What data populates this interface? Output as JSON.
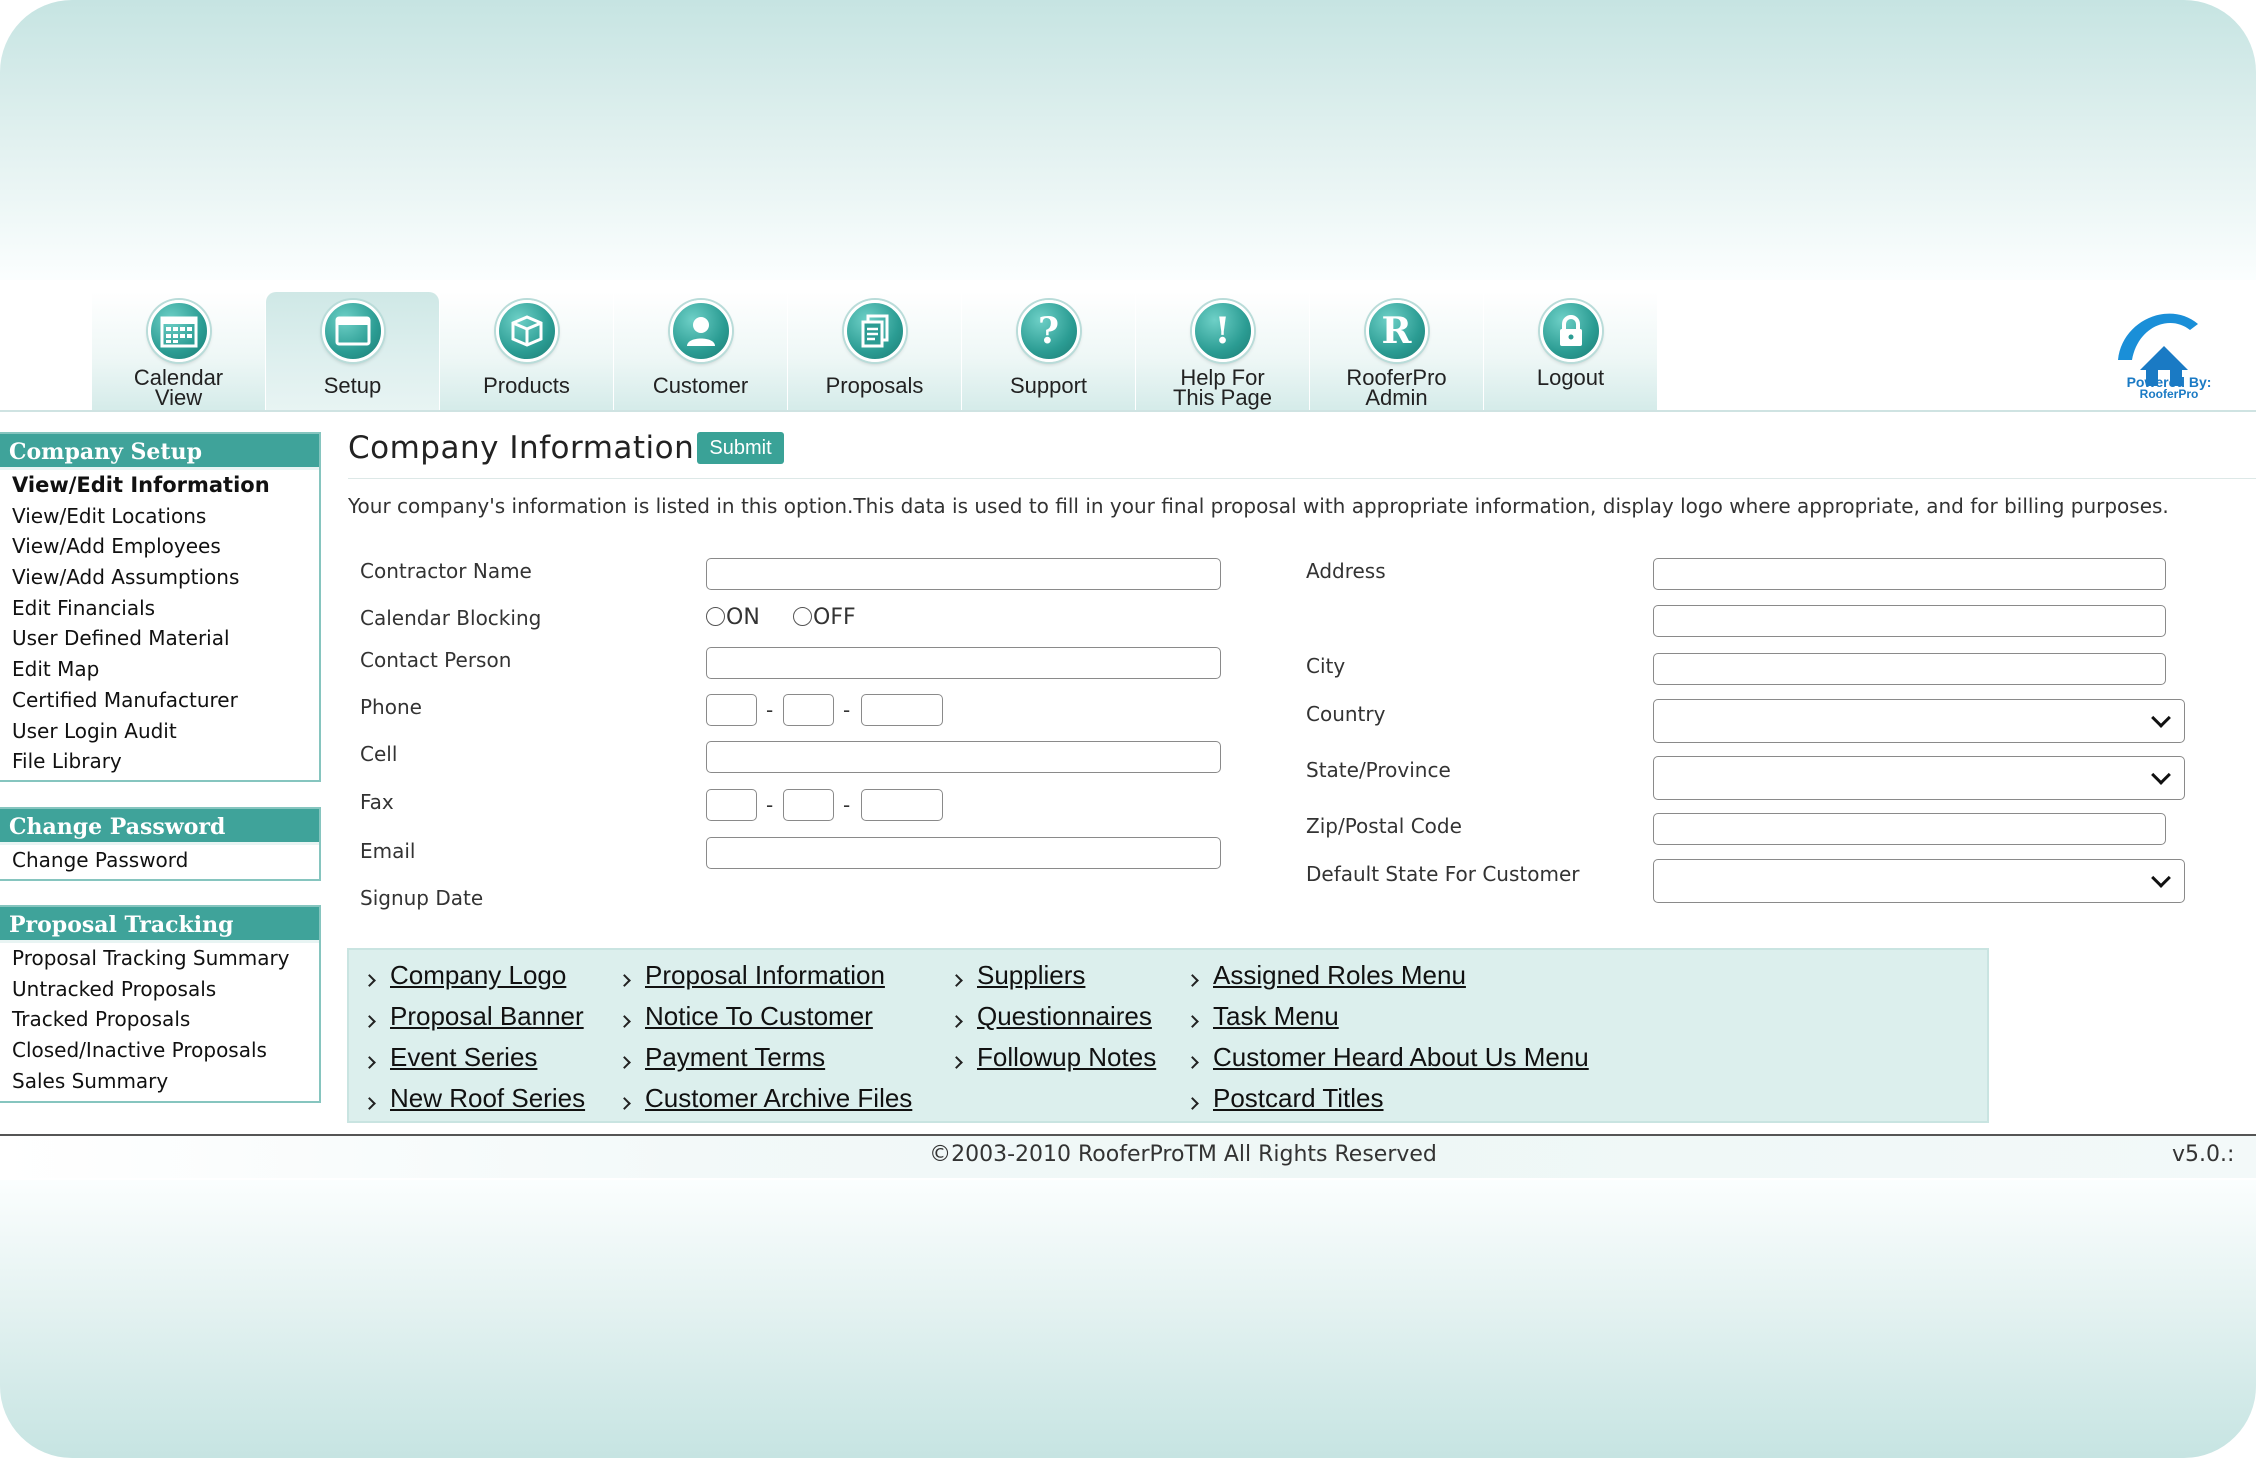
{
  "nav": {
    "tabs": [
      {
        "label": "Calendar\nView",
        "icon": "calendar-icon"
      },
      {
        "label": "Setup",
        "icon": "window-icon"
      },
      {
        "label": "Products",
        "icon": "box-icon"
      },
      {
        "label": "Customer",
        "icon": "person-icon"
      },
      {
        "label": "Proposals",
        "icon": "documents-icon"
      },
      {
        "label": "Support",
        "icon": "question-icon",
        "glyph": "?"
      },
      {
        "label": "Help For\nThis Page",
        "icon": "exclamation-icon",
        "glyph": "!"
      },
      {
        "label": "RooferPro\nAdmin",
        "icon": "r-letter-icon",
        "glyph": "R"
      },
      {
        "label": "Logout",
        "icon": "lock-icon"
      }
    ],
    "active": "Setup"
  },
  "branding": {
    "powered_by": "Powered By:",
    "brand": "RooferPro"
  },
  "sidebar": {
    "company_setup": {
      "title": "Company Setup",
      "items": [
        "View/Edit Information",
        "View/Edit Locations",
        "View/Add Employees",
        "View/Add Assumptions",
        "Edit Financials",
        "User Defined Material",
        "Edit Map",
        "Certified Manufacturer",
        "User Login Audit",
        "File Library"
      ],
      "current": "View/Edit Information"
    },
    "change_password": {
      "title": "Change Password",
      "items": [
        "Change Password"
      ]
    },
    "proposal_tracking": {
      "title": "Proposal Tracking",
      "items": [
        "Proposal Tracking Summary",
        "Untracked Proposals",
        "Tracked Proposals",
        "Closed/Inactive Proposals",
        "Sales Summary"
      ]
    }
  },
  "main": {
    "title": "Company Information",
    "submit_label": "Submit",
    "description": "Your company's information is listed in this option.This data is used to fill in your final proposal with appropriate information, display logo where appropriate, and for billing purposes.",
    "left_fields": {
      "contractor_name": {
        "label": "Contractor Name",
        "value": ""
      },
      "calendar_blocking": {
        "label": "Calendar Blocking",
        "on": "ON",
        "off": "OFF",
        "selected": ""
      },
      "contact_person": {
        "label": "Contact Person",
        "value": ""
      },
      "phone": {
        "label": "Phone",
        "separator": "-"
      },
      "cell": {
        "label": "Cell",
        "value": ""
      },
      "fax": {
        "label": "Fax",
        "separator": "-"
      },
      "email": {
        "label": "Email",
        "value": ""
      },
      "signup_date": {
        "label": "Signup Date",
        "value": ""
      }
    },
    "right_fields": {
      "address": {
        "label": "Address",
        "value1": "",
        "value2": ""
      },
      "city": {
        "label": "City",
        "value": ""
      },
      "country": {
        "label": "Country",
        "selected": ""
      },
      "state": {
        "label": "State/Province",
        "selected": ""
      },
      "zip": {
        "label": "Zip/Postal Code",
        "value": ""
      },
      "default_state": {
        "label": "Default State For Customer",
        "selected": ""
      }
    }
  },
  "links": {
    "col1": [
      "Company Logo",
      "Proposal Banner",
      "Event Series",
      "New Roof Series"
    ],
    "col2": [
      "Proposal Information",
      "Notice To Customer",
      "Payment Terms",
      "Customer Archive Files"
    ],
    "col3": [
      "Suppliers",
      "Questionnaires",
      "Followup Notes"
    ],
    "col4": [
      "Assigned Roles Menu",
      "Task Menu",
      "Customer Heard About Us Menu",
      "Postcard Titles"
    ]
  },
  "footer": {
    "copyright": "©2003-2010 RooferProTM All Rights Reserved",
    "version": "v5.0.:"
  },
  "colors": {
    "accent": "#3fa39a",
    "panel": "#dcefed",
    "brand_blue": "#1a7ac4"
  }
}
